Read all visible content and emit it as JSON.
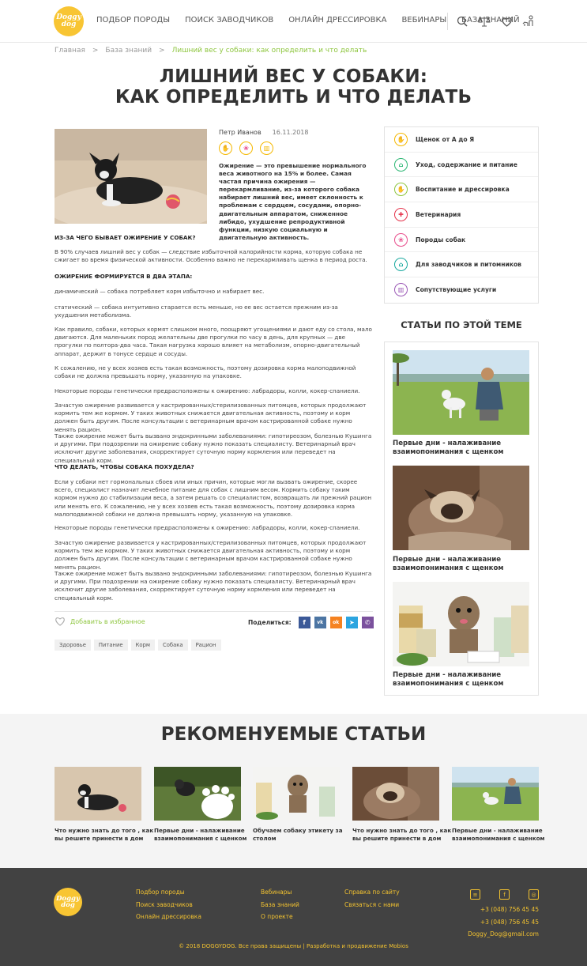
{
  "header": {
    "logo_line1": "Doggy",
    "logo_line2": "dog",
    "nav": [
      "ПОДБОР ПОРОДЫ",
      "ПОИСК ЗАВОДЧИКОВ",
      "ОНЛАЙН ДРЕССИРОВКА",
      "ВЕБИНАРЫ",
      "БАЗА ЗНАНИЙ"
    ],
    "icons": [
      "search-icon",
      "scales-icon",
      "heart-icon",
      "dog-user-icon"
    ]
  },
  "breadcrumb": {
    "home": "Главная",
    "section": "База знаний",
    "current": "Лишний вес у собаки: как определить и что делать"
  },
  "article": {
    "title_line1": "ЛИШНИЙ ВЕС У СОБАКИ:",
    "title_line2": "КАК ОПРЕДЕЛИТЬ И ЧТО ДЕЛАТЬ",
    "author": "Петр Иванов",
    "date": "16.11.2018",
    "lead": "Ожирение — это превышение нормального веса животного на 15% и более. Самая частая причина ожирения — перекармливание, из-за которого собака набирает лишний вес, имеет склонность к проблемам с сердцем, сосудами, опорно-двигательным аппаратом, сниженное либидо, ухудшение репродуктивной функции, низкую социальную и двигательную активность.",
    "h_causes": "ИЗ-ЗА ЧЕГО БЫВАЕТ ОЖИРЕНИЕ У СОБАК?",
    "p1": "В 90% случаев лишний вес у собак — следствие избыточной калорийности корма, которую собака не сжигает во время физической активности. Особенно важно не перекармливать щенка в период роста.",
    "h_stages": "ОЖИРЕНИЕ ФОРМИРУЕТСЯ В ДВА ЭТАПА:",
    "p2": "динамический — собака потребляет корм избыточно и набирает вес.",
    "p3": "статический — собака интуитивно старается есть меньше, но ее вес остается прежним из-за ухудшения метаболизма.",
    "p4": "Как правило, собаки, которых кормят слишком много, поощряют угощениями и дают еду со стола, мало двигаются. Для маленьких пород желательны две прогулки по часу в день, для крупных — две прогулки по полтора-два часа. Такая нагрузка хорошо влияет на метаболизм, опорно-двигательный аппарат, держит в тонусе сердце и сосуды.",
    "p5": "К сожалению, не у всех хозяев есть такая возможность, поэтому дозировка корма малоподвижной собаки не должна превышать норму, указанную на упаковке.",
    "p6": "Некоторые породы генетически предрасположены к ожирению: лабрадоры, колли, кокер-спаниели.",
    "p7": "Зачастую ожирение развивается у кастрированных/стерилизованных питомцев, которых продолжают кормить тем же кормом. У таких животных снижается двигательная активность, поэтому и корм должен быть другим. После консультации с ветеринарным врачом кастрированной собаке нужно менять рацион.",
    "p8": "Также ожирение может быть вызвано эндокринными заболеваниями: гипотиреозом, болезнью Кушинга и другими. При подозрении на ожирение собаку нужно показать специалисту. Ветеринарный врач исключит другие заболевания, скорректирует суточную норму кормления или переведет на специальный корм.",
    "h_what": "ЧТО ДЕЛАТЬ, ЧТОБЫ СОБАКА ПОХУДЕЛА?",
    "p9": "Если у собаки нет гормональных сбоев или иных причин, которые могли вызвать ожирение, скорее всего, специалист назначит лечебное питание для собак с лишним весом. Кормить собаку таким кормом нужно до стабилизации веса, а затем решать со специалистом, возвращать ли прежний рацион или менять его. К сожалению, не у всех хозяев есть такая возможность, поэтому дозировка корма малоподвижной собаки не должна превышать норму, указанную на упаковке.",
    "p10": "Некоторые породы генетически предрасположены к ожирению: лабрадоры, колли, кокер-спаниели.",
    "p11": "Зачастую ожирение развивается у кастрированных/стерилизованных питомцев, которых продолжают кормить тем же кормом. У таких животных снижается двигательная активность, поэтому и корм должен быть другим. После консультации с ветеринарным врачом кастрированной собаке нужно менять рацион.",
    "p12": "Также ожирение может быть вызвано эндокринными заболеваниями: гипотиреозом, болезнью Кушинга и другими. При подозрении на ожирение собаку нужно показать специалисту. Ветеринарный врач исключит другие заболевания, скорректирует суточную норму кормления или переведет на специальный корм.",
    "favorite": "Добавить в избранное",
    "share_label": "Поделиться:",
    "share": [
      {
        "icon": "facebook-icon",
        "glyph": "f",
        "color": "#3b5998"
      },
      {
        "icon": "vk-icon",
        "glyph": "vk",
        "color": "#4c75a3"
      },
      {
        "icon": "odnoklassniki-icon",
        "glyph": "ok",
        "color": "#f58220"
      },
      {
        "icon": "telegram-icon",
        "glyph": "➤",
        "color": "#2ca5e0"
      },
      {
        "icon": "viber-icon",
        "glyph": "✆",
        "color": "#7b519d"
      }
    ],
    "tags": [
      "Здоровье",
      "Питание",
      "Корм",
      "Собака",
      "Рацион"
    ]
  },
  "sidebar": {
    "categories": [
      {
        "label": "Щенок от А до Я",
        "color": "#f5b800"
      },
      {
        "label": "Уход, содержание и питание",
        "color": "#2bb673"
      },
      {
        "label": "Воспитание и дрессировка",
        "color": "#8ec63f"
      },
      {
        "label": "Ветеринария",
        "color": "#e5334b"
      },
      {
        "label": "Породы собак",
        "color": "#e84c8b"
      },
      {
        "label": "Для заводчиков и питомников",
        "color": "#17a89e"
      },
      {
        "label": "Сопутствующие услуги",
        "color": "#9b59b6"
      }
    ],
    "related_title": "СТАТЬИ ПО ЭТОЙ ТЕМЕ",
    "related": [
      {
        "caption_line1": "Первые дни - налаживание",
        "caption_line2": "взаимопонимания с щенком"
      },
      {
        "caption_line1": "Первые дни - налаживание",
        "caption_line2": "взаимопонимания с щенком"
      },
      {
        "caption_line1": "Первые дни - налаживание",
        "caption_line2": "взаимопонимания с щенком"
      }
    ]
  },
  "recommended": {
    "title": "РЕКОМЕНУЕМЫЕ СТАТЬИ",
    "items": [
      {
        "line1": "Что нужно знать до того , как",
        "line2": "вы решите принести в дом"
      },
      {
        "line1": "Первые дни - налаживание",
        "line2": "взаимопонимания с щенком"
      },
      {
        "line1": "Обучаем собаку этикету за",
        "line2": "столом"
      },
      {
        "line1": "Что нужно знать до того , как",
        "line2": "вы решите принести в дом"
      },
      {
        "line1": "Первые дни - налаживание",
        "line2": "взаимопонимания с щенком"
      }
    ]
  },
  "footer": {
    "col1": [
      "Подбор породы",
      "Поиск заводчиков",
      "Онлайн дрессировка"
    ],
    "col2": [
      "Вебинары",
      "База знаний",
      "О проекте"
    ],
    "col3": [
      "Справка по сайту",
      "Связаться с нами"
    ],
    "phone1": "+3 (048) 756 45 45",
    "phone2": "+3 (048) 756 45 45",
    "email": "Doggy_Dog@gmail.com",
    "copyright": "© 2018 DOGGYDOG. Все права защищены | Разработка и продвижение Mobios",
    "social": [
      "document-icon",
      "facebook-icon",
      "instagram-icon"
    ]
  }
}
